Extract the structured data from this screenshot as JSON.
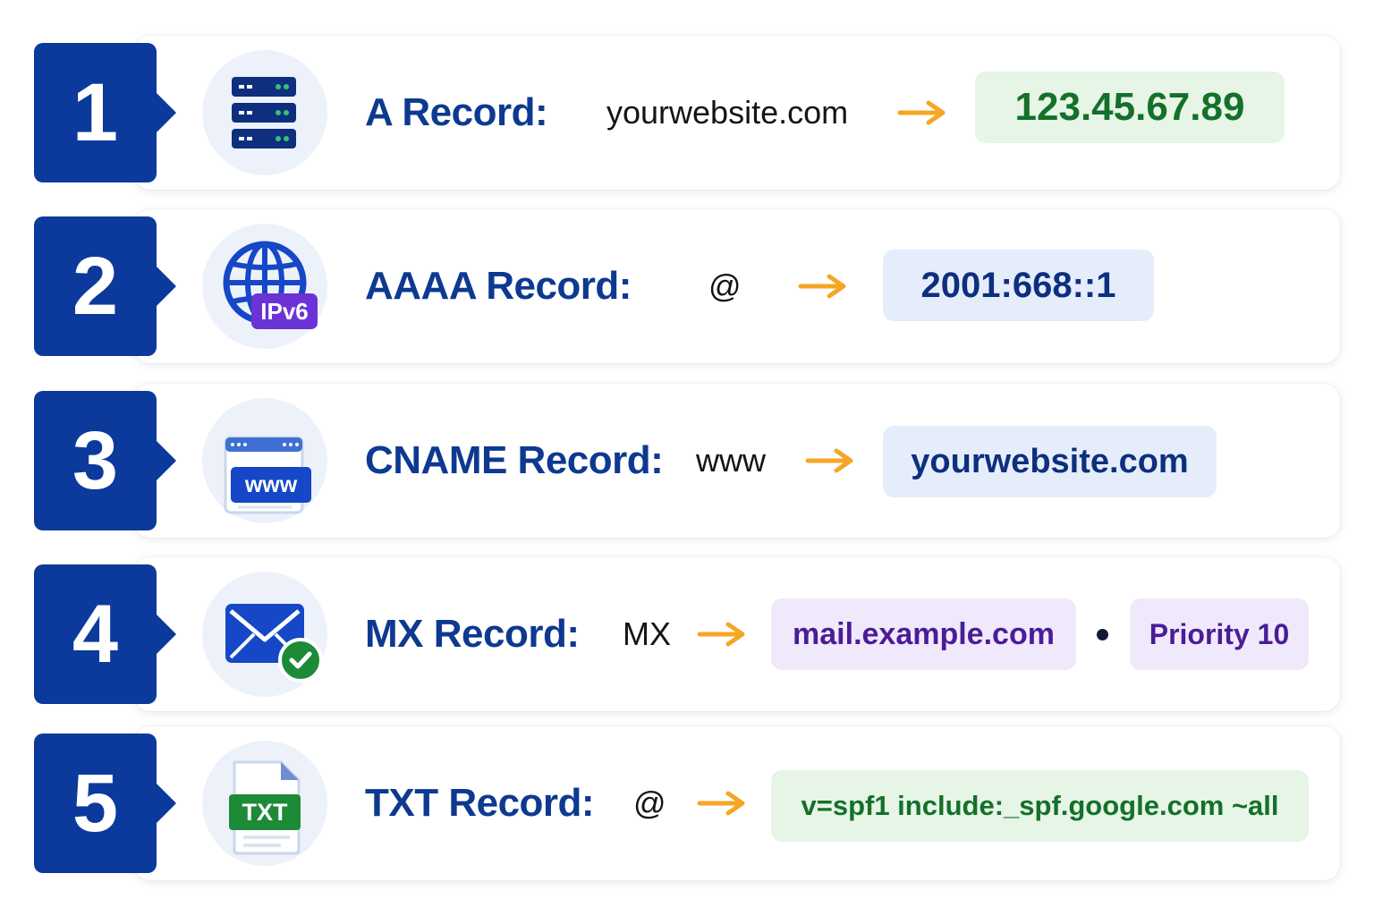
{
  "records": [
    {
      "number": "1",
      "icon": "server-icon",
      "label": "A Record:",
      "host": "yourwebsite.com",
      "value": "123.45.67.89"
    },
    {
      "number": "2",
      "icon": "globe-ipv6-icon",
      "icon_badge": "IPv6",
      "label": "AAAA Record:",
      "host": "@",
      "value": "2001:668::1"
    },
    {
      "number": "3",
      "icon": "browser-www-icon",
      "icon_badge": "www",
      "label": "CNAME Record:",
      "host": "www",
      "value": "yourwebsite.com"
    },
    {
      "number": "4",
      "icon": "envelope-check-icon",
      "label": "MX Record:",
      "host": "MX",
      "value": "mail.example.com",
      "priority": "Priority 10"
    },
    {
      "number": "5",
      "icon": "txt-file-icon",
      "icon_badge": "TXT",
      "label": "TXT Record:",
      "host": "@",
      "value": "v=spf1 include:_spf.google.com ~all"
    }
  ],
  "colors": {
    "badge": "#0b3a9c",
    "label": "#0d3990",
    "arrow": "#f5a623",
    "green_pill": "#e6f5e6",
    "blue_pill": "#e5edfb",
    "purple_pill": "#f0e9fb"
  }
}
